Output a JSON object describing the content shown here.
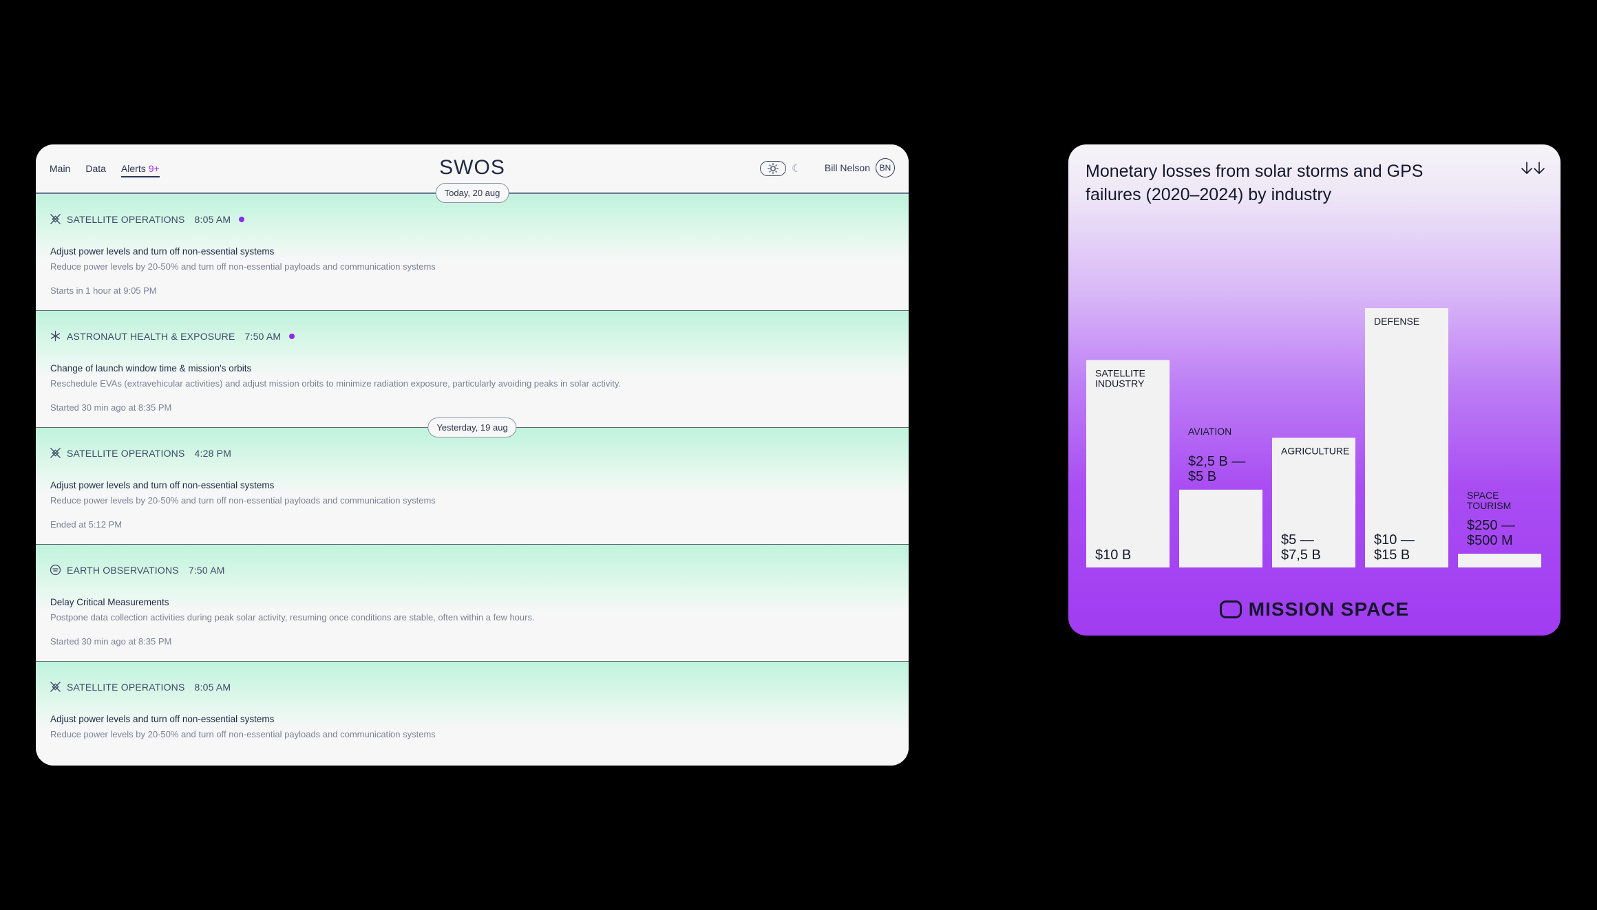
{
  "app": {
    "nav": [
      {
        "label": "Main"
      },
      {
        "label": "Data"
      },
      {
        "label": "Alerts",
        "badge": "9+"
      }
    ],
    "brand": "SWOS",
    "user": {
      "name": "Bill Nelson",
      "initials": "BN"
    }
  },
  "feed": {
    "dates": [
      "Today, 20 aug",
      "Yesterday, 19 aug"
    ],
    "cards": [
      {
        "category": "SATELLITE OPERATIONS",
        "time": "8:05 AM",
        "icon": "satellite-icon",
        "unread": true,
        "title": "Adjust power levels and turn off non-essential systems",
        "desc": "Reduce power levels by 20-50% and turn off non-essential payloads and communication systems",
        "foot": "Starts in 1 hour at 9:05 PM"
      },
      {
        "category": "ASTRONAUT HEALTH & EXPOSURE",
        "time": "7:50 AM",
        "icon": "asterisk-icon",
        "unread": true,
        "title": "Change of launch window time & mission's orbits",
        "desc": "Reschedule EVAs (extravehicular activities) and adjust mission orbits to minimize radiation exposure, particularly avoiding peaks in solar activity.",
        "foot": "Started 30 min ago at 8:35 PM"
      },
      {
        "category": "SATELLITE OPERATIONS",
        "time": "4:28 PM",
        "icon": "satellite-icon",
        "unread": false,
        "title": "Adjust power levels and turn off non-essential systems",
        "desc": "Reduce power levels by 20-50% and turn off non-essential payloads and communication systems",
        "foot": "Ended at 5:12 PM"
      },
      {
        "category": "EARTH OBSERVATIONS",
        "time": "7:50 AM",
        "icon": "earth-icon",
        "unread": false,
        "title": "Delay Critical Measurements",
        "desc": "Postpone data collection activities during peak solar activity, resuming once conditions are stable, often within a few hours.",
        "foot": "Started 30 min ago at 8:35 PM"
      },
      {
        "category": "SATELLITE OPERATIONS",
        "time": "8:05 AM",
        "icon": "satellite-icon",
        "unread": false,
        "title": "Adjust power levels and turn off non-essential systems",
        "desc": "Reduce power levels by 20-50% and turn off non-essential payloads and communication systems",
        "foot": ""
      }
    ]
  },
  "chart_panel": {
    "download_icon": "download-icon",
    "logo_text": "MISSION SPACE"
  },
  "chart_data": {
    "type": "bar",
    "title": "Monetary losses from solar storms and GPS failures (2020–2024) by industry",
    "categories": [
      "SATELLITE INDUSTRY",
      "AVIATION",
      "AGRICULTURE",
      "DEFENSE",
      "SPACE TOURISM"
    ],
    "category_lines": [
      [
        "SATELLITE",
        "INDUSTRY"
      ],
      [
        "AVIATION"
      ],
      [
        "AGRICULTURE"
      ],
      [
        "DEFENSE"
      ],
      [
        "SPACE",
        "TOURISM"
      ]
    ],
    "value_labels": [
      [
        "$10 B"
      ],
      [
        "$2,5 B —",
        "$5 B"
      ],
      [
        "$5 —",
        "$7,5 B"
      ],
      [
        "$10 —",
        "$15 B"
      ],
      [
        "$250 —",
        "$500 M"
      ]
    ],
    "values_billion_usd": [
      10,
      3.75,
      6.25,
      12.5,
      0.375
    ],
    "ylim": [
      0,
      12.5
    ],
    "colors": {
      "bar": "#f2f2f3",
      "text": "#14182a"
    }
  }
}
